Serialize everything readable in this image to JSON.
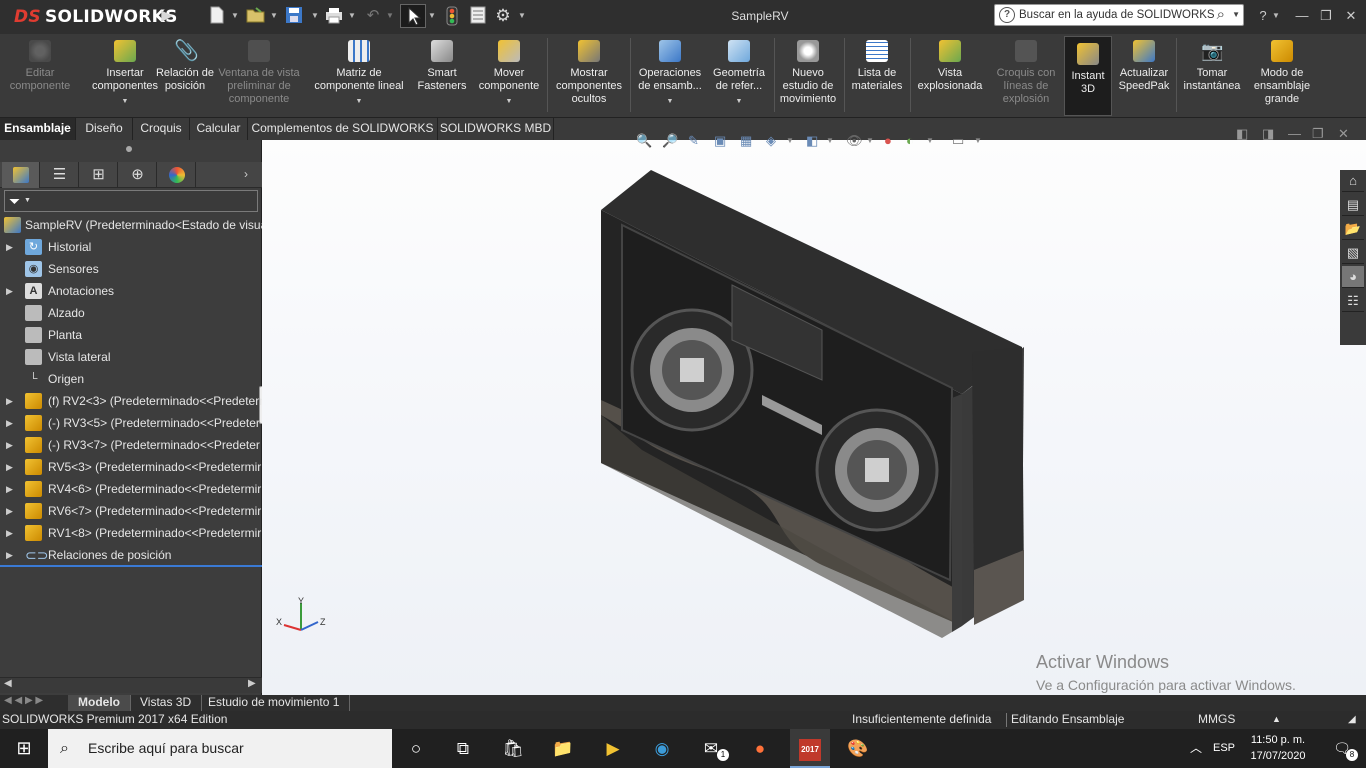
{
  "app": {
    "logo_ds": "DS",
    "logo_text": "SOLIDWORKS",
    "doc_title": "SampleRV",
    "help_placeholder": "Buscar en la ayuda de SOLIDWORKS",
    "help_icon": "question-mark"
  },
  "ribbon": {
    "buttons": [
      {
        "label": "Editar componente",
        "icon": "edit-component-icon",
        "disabled": true
      },
      {
        "label": "Insertar componentes",
        "icon": "insert-components-icon",
        "disabled": false
      },
      {
        "label": "Relación de posición",
        "icon": "mate-icon",
        "disabled": false
      },
      {
        "label": "Ventana de vista preliminar de componente",
        "icon": "preview-window-icon",
        "disabled": true
      },
      {
        "label": "Matriz de componente lineal",
        "icon": "linear-pattern-icon",
        "disabled": false
      },
      {
        "label": "Smart Fasteners",
        "icon": "smart-fasteners-icon",
        "disabled": false
      },
      {
        "label": "Mover componente",
        "icon": "move-component-icon",
        "disabled": false
      },
      {
        "label": "Mostrar componentes ocultos",
        "icon": "show-hidden-icon",
        "disabled": false
      },
      {
        "label": "Operaciones de ensamb...",
        "icon": "assembly-features-icon",
        "disabled": false
      },
      {
        "label": "Geometría de refer...",
        "icon": "reference-geometry-icon",
        "disabled": false
      },
      {
        "label": "Nuevo estudio de movimiento",
        "icon": "motion-study-icon",
        "disabled": false
      },
      {
        "label": "Lista de materiales",
        "icon": "bom-icon",
        "disabled": false
      },
      {
        "label": "Vista explosionada",
        "icon": "exploded-view-icon",
        "disabled": false
      },
      {
        "label": "Croquis con líneas de explosión",
        "icon": "explode-line-sketch-icon",
        "disabled": true
      },
      {
        "label": "Instant 3D",
        "icon": "instant3d-icon",
        "disabled": false
      },
      {
        "label": "Actualizar SpeedPak",
        "icon": "speedpak-icon",
        "disabled": false
      },
      {
        "label": "Tomar instantánea",
        "icon": "camera-icon",
        "disabled": false
      },
      {
        "label": "Modo de ensamblaje grande",
        "icon": "large-assembly-icon",
        "disabled": false
      }
    ]
  },
  "command_tabs": [
    "Ensamblaje",
    "Diseño",
    "Croquis",
    "Calcular",
    "Complementos de SOLIDWORKS",
    "SOLIDWORKS MBD"
  ],
  "tree": {
    "root": "SampleRV  (Predeterminado<Estado de visua",
    "items": [
      {
        "label": "Historial",
        "expandable": true
      },
      {
        "label": "Sensores",
        "expandable": false
      },
      {
        "label": "Anotaciones",
        "expandable": true
      },
      {
        "label": "Alzado",
        "expandable": false
      },
      {
        "label": "Planta",
        "expandable": false
      },
      {
        "label": "Vista lateral",
        "expandable": false
      },
      {
        "label": "Origen",
        "expandable": false
      },
      {
        "label": "(f) RV2<3> (Predeterminado<<Predetern",
        "expandable": true
      },
      {
        "label": "(-) RV3<5> (Predeterminado<<Predeter",
        "expandable": true
      },
      {
        "label": "(-) RV3<7> (Predeterminado<<Predeter",
        "expandable": true
      },
      {
        "label": "RV5<3> (Predeterminado<<Predetermir",
        "expandable": true
      },
      {
        "label": "RV4<6> (Predeterminado<<Predetermir",
        "expandable": true
      },
      {
        "label": "RV6<7> (Predeterminado<<Predetermir",
        "expandable": true
      },
      {
        "label": "RV1<8> (Predeterminado<<Predetermir",
        "expandable": true
      },
      {
        "label": "Relaciones de posición",
        "expandable": true
      }
    ]
  },
  "triad": {
    "x": "X",
    "y": "Y",
    "z": "Z"
  },
  "watermark": {
    "title": "Activar Windows",
    "subtitle": "Ve a Configuración para activar Windows."
  },
  "bottom_tabs": [
    "Modelo",
    "Vistas 3D",
    "Estudio de movimiento 1"
  ],
  "status": {
    "edition": "SOLIDWORKS Premium 2017 x64 Edition",
    "definition": "Insuficientemente definida",
    "mode": "Editando Ensamblaje",
    "units": "MMGS"
  },
  "taskbar": {
    "search_placeholder": "Escribe aquí para buscar",
    "language": "ESP",
    "time": "11:50 p. m.",
    "date": "17/07/2020",
    "notifications": "8",
    "mail_badge": "1",
    "sw_badge": "2017"
  },
  "colors": {
    "accent": "#3a7ad5",
    "brand": "#e03c31",
    "model_dark": "#2a2a2a",
    "model_bottom": "#5a5550"
  }
}
